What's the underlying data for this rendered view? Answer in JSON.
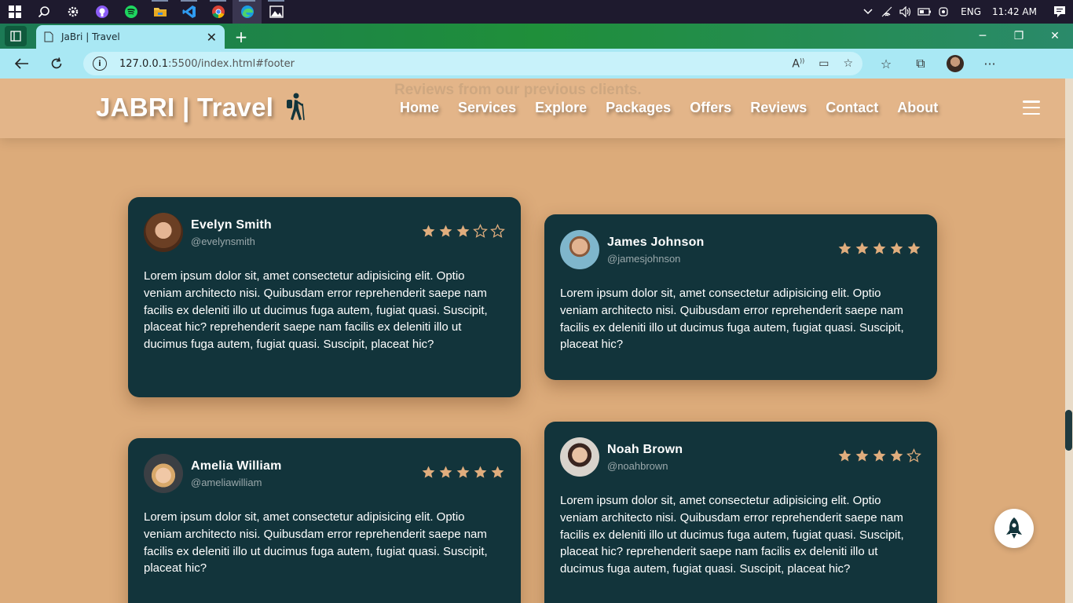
{
  "taskbar": {
    "lang": "ENG",
    "clock": "11:42 AM"
  },
  "browser": {
    "tab_title": "JaBri | Travel",
    "url_host": "127.0.0.1",
    "url_path": ":5500/index.html#footer"
  },
  "site": {
    "ghost_heading": "Reviews from our previous clients.",
    "logo": "JABRI | Travel",
    "nav": [
      "Home",
      "Services",
      "Explore",
      "Packages",
      "Offers",
      "Reviews",
      "Contact",
      "About"
    ]
  },
  "reviews": [
    {
      "name": "Evelyn Smith",
      "handle": "@evelynsmith",
      "rating": 3,
      "text": "Lorem ipsum dolor sit, amet consectetur adipisicing elit. Optio veniam architecto nisi. Quibusdam error reprehenderit saepe nam facilis ex deleniti illo ut ducimus fuga autem, fugiat quasi. Suscipit, placeat hic? reprehenderit saepe nam facilis ex deleniti illo ut ducimus fuga autem, fugiat quasi. Suscipit, placeat hic?"
    },
    {
      "name": "James Johnson",
      "handle": "@jamesjohnson",
      "rating": 5,
      "text": "Lorem ipsum dolor sit, amet consectetur adipisicing elit. Optio veniam architecto nisi. Quibusdam error reprehenderit saepe nam facilis ex deleniti illo ut ducimus fuga autem, fugiat quasi. Suscipit, placeat hic?"
    },
    {
      "name": "Amelia William",
      "handle": "@ameliawilliam",
      "rating": 5,
      "text": "Lorem ipsum dolor sit, amet consectetur adipisicing elit. Optio veniam architecto nisi. Quibusdam error reprehenderit saepe nam facilis ex deleniti illo ut ducimus fuga autem, fugiat quasi. Suscipit, placeat hic?"
    },
    {
      "name": "Noah Brown",
      "handle": "@noahbrown",
      "rating": 4,
      "text": "Lorem ipsum dolor sit, amet consectetur adipisicing elit. Optio veniam architecto nisi. Quibusdam error reprehenderit saepe nam facilis ex deleniti illo ut ducimus fuga autem, fugiat quasi. Suscipit, placeat hic? reprehenderit saepe nam facilis ex deleniti illo ut ducimus fuga autem, fugiat quasi. Suscipit, placeat hic?"
    }
  ],
  "colors": {
    "card_bg": "#12343b",
    "star": "#e0ad7d",
    "page_bg": "#dcab7a"
  }
}
